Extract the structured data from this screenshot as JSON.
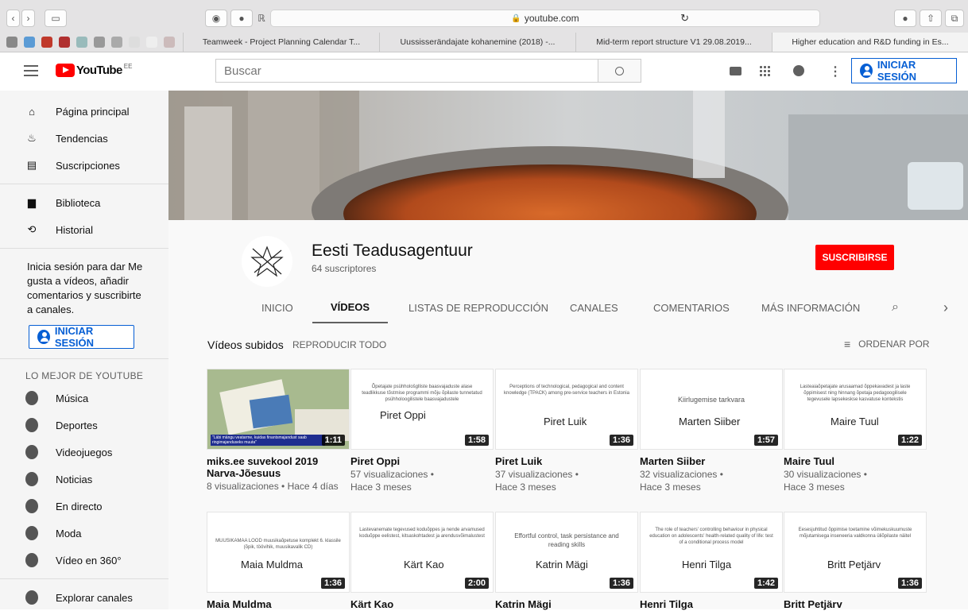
{
  "browser": {
    "url": "youtube.com",
    "tabs": [
      "Teamweek - Project Planning Calendar T...",
      "Uussisserändajate kohanemine (2018) -...",
      "Mid-term report structure V1 29.08.2019...",
      "Higher education and R&D funding in Es..."
    ]
  },
  "header": {
    "logo_text": "YouTube",
    "logo_region": "EE",
    "search_placeholder": "Buscar",
    "signin_label": "INICIAR SESIÓN"
  },
  "sidebar": {
    "main": [
      {
        "label": "Página principal",
        "icon": "home-icon"
      },
      {
        "label": "Tendencias",
        "icon": "flame-icon"
      },
      {
        "label": "Suscripciones",
        "icon": "subscriptions-icon"
      }
    ],
    "library": [
      {
        "label": "Biblioteca",
        "icon": "folder-icon"
      },
      {
        "label": "Historial",
        "icon": "history-icon"
      }
    ],
    "signin_prompt": "Inicia sesión para dar Me gusta a vídeos, añadir comentarios y suscribirte a canales.",
    "signin_label": "INICIAR SESIÓN",
    "best_heading": "LO MEJOR DE YOUTUBE",
    "best": [
      {
        "label": "Música",
        "icon": "music-icon"
      },
      {
        "label": "Deportes",
        "icon": "sports-icon"
      },
      {
        "label": "Videojuegos",
        "icon": "gaming-icon"
      },
      {
        "label": "Noticias",
        "icon": "news-icon"
      },
      {
        "label": "En directo",
        "icon": "live-icon"
      },
      {
        "label": "Moda",
        "icon": "fashion-icon"
      },
      {
        "label": "Vídeo en 360°",
        "icon": "vr-icon"
      }
    ],
    "explore": "Explorar canales"
  },
  "channel": {
    "name": "Eesti Teadusagentuur",
    "subscribers": "64 suscriptores",
    "subscribe_label": "SUSCRIBIRSE",
    "tabs": [
      "INICIO",
      "VÍDEOS",
      "LISTAS DE REPRODUCCIÓN",
      "CANALES",
      "COMENTARIOS",
      "MÁS INFORMACIÓN"
    ],
    "active_tab": "VÍDEOS"
  },
  "section": {
    "title": "Vídeos subidos",
    "play_all": "REPRODUCIR TODO",
    "sort": "ORDENAR POR"
  },
  "videos": [
    {
      "title": "miks.ee suvekool 2019 Narva-Jõesuus",
      "duration": "1:11",
      "views": "8 visualizaciones",
      "age": "Hace 4 días",
      "caption": "\"Läbi mängu veatarme, kuidas finantsmajandust saab ringimajanduseks muuta\"",
      "photo": true
    },
    {
      "title": "Piret Oppi",
      "duration": "1:58",
      "views": "57 visualizaciones",
      "age": "Hace 3 meses",
      "topic": "Õpetajate psühhološglliste baasvajaduste alase teadlikkuse tõstmise programmi mõju õpilaste tunnetatud psühholoogilistele baasvajadustele",
      "name": "Piret Oppi"
    },
    {
      "title": "Piret Luik",
      "duration": "1:36",
      "views": "37 visualizaciones",
      "age": "Hace 3 meses",
      "topic": "Perceptions of technological, pedagogical and content knowledge (TPACK) among pre-service teachers in Estonia",
      "name": "Piret Luik"
    },
    {
      "title": "Marten Siiber",
      "duration": "1:57",
      "views": "32 visualizaciones",
      "age": "Hace 3 meses",
      "topic": "Kiirlugemise tarkvara",
      "name": "Marten Siiber"
    },
    {
      "title": "Maire Tuul",
      "duration": "1:22",
      "views": "30 visualizaciones",
      "age": "Hace 3 meses",
      "topic": "Lasteaiaõpetajate arusaamad õppekavadest ja laste õppimisest ning hinnang õpetaja pedagoogilisele tegevusele lapsekeskse kasvatuse kontekstis",
      "name": "Maire Tuul"
    },
    {
      "title": "Maia Muldma",
      "duration": "1:36",
      "topic": "MUUSIKAMAA LOOD muusikaõpetuse komplekt 6. klassile (õpik, töövihik, muusikavalik CD)",
      "name": "Maia Muldma"
    },
    {
      "title": "Kärt Kao",
      "duration": "2:00",
      "topic": "Lastevanemate tegevused koduõppes ja nende arvamused koduõppe eelistest, kitsaskohtadest ja arendusvõimalustest",
      "name": "Kärt Kao"
    },
    {
      "title": "Katrin Mägi",
      "duration": "1:36",
      "topic": "Effortful control, task persistance and reading skills",
      "name": "Katrin Mägi"
    },
    {
      "title": "Henri Tilga",
      "duration": "1:42",
      "topic": "The role of teachers' controlling behaviour in physical education on adolescents' health-related quality of life: test of a conditional process model",
      "name": "Henri Tilga"
    },
    {
      "title": "Britt Petjärv",
      "duration": "1:36",
      "topic": "Eesesjuhtitud õppimise toetamine võimekuskuumuste mõjutamisega inseneeria valdkonna üliõpilaste näitel",
      "name": "Britt Petjärv"
    }
  ],
  "colors": {
    "subscribe": "#ff0000",
    "accent": "#065fd4",
    "logo_red": "#ff0000"
  }
}
